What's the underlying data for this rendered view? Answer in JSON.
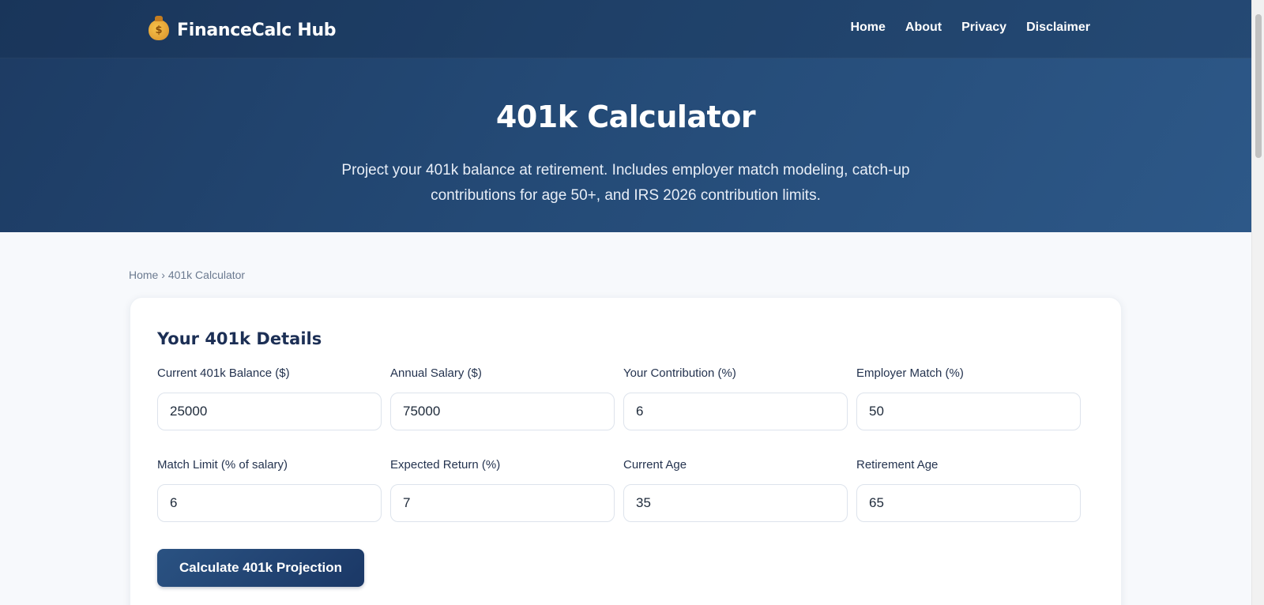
{
  "brand": {
    "name": "FinanceCalc Hub",
    "icon": "money-bag-icon"
  },
  "nav": {
    "items": [
      "Home",
      "About",
      "Privacy",
      "Disclaimer"
    ]
  },
  "hero": {
    "title": "401k Calculator",
    "subtitle_line1": "Project your 401k balance at retirement. Includes employer match modeling, catch-up",
    "subtitle_line2": "contributions for age 50+, and IRS 2026 contribution limits."
  },
  "breadcrumb": {
    "home": "Home",
    "separator": "›",
    "current": "401k Calculator"
  },
  "form": {
    "title": "Your 401k Details",
    "fields": [
      {
        "label": "Current 401k Balance ($)",
        "value": "25000"
      },
      {
        "label": "Annual Salary ($)",
        "value": "75000"
      },
      {
        "label": "Your Contribution (%)",
        "value": "6"
      },
      {
        "label": "Employer Match (%)",
        "value": "50"
      },
      {
        "label": "Match Limit (% of salary)",
        "value": "6"
      },
      {
        "label": "Expected Return (%)",
        "value": "7"
      },
      {
        "label": "Current Age",
        "value": "35"
      },
      {
        "label": "Retirement Age",
        "value": "65"
      }
    ],
    "submit_label": "Calculate 401k Projection"
  },
  "colors": {
    "hero_start": "#1d3b63",
    "hero_end": "#2d5888",
    "button": "#1b3866",
    "page_bg": "#f7f9fc"
  }
}
